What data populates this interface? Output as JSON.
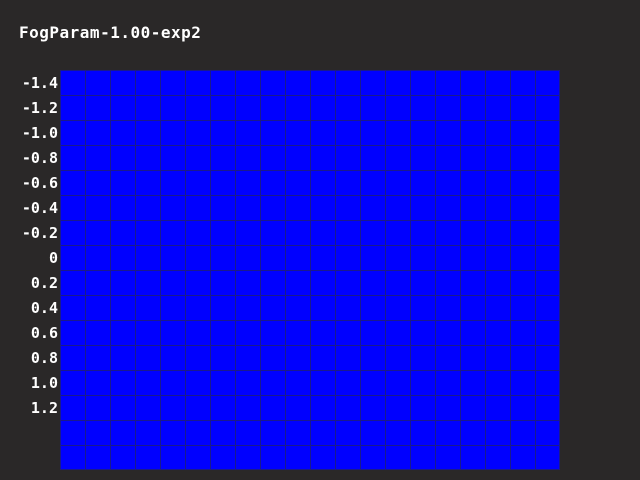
{
  "title": "FogParam-1.00-exp2",
  "grid": {
    "color": "#0000ff",
    "line_color": "#1a1a8c",
    "columns": 20,
    "rows": 16
  },
  "y_labels": [
    "-1.4",
    "-1.2",
    "-1.0",
    "-0.8",
    "-0.6",
    "-0.4",
    "-0.2",
    "0",
    "0.2",
    "0.4",
    "0.6",
    "0.8",
    "1.0",
    "1.2"
  ]
}
